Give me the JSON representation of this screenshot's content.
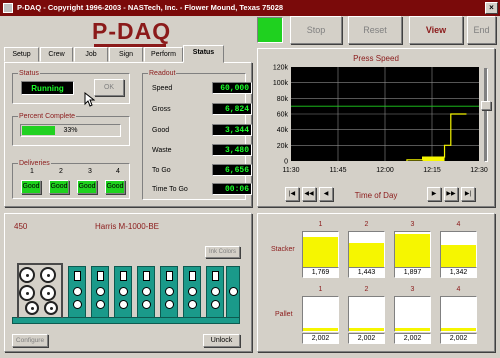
{
  "window": {
    "title": "P-DAQ - Copyright 1996-2003 - NASTech, Inc. - Flower Mound, Texas  75028",
    "close_glyph": "×"
  },
  "logo": "P-DAQ",
  "toolbar": {
    "stop": "Stop",
    "reset": "Reset",
    "view": "View",
    "end": "End"
  },
  "tabs": [
    "Setup",
    "Crew",
    "Job",
    "Sign",
    "Perform",
    "Status"
  ],
  "status": {
    "group": "Status",
    "value": "Running",
    "ok": "OK"
  },
  "percent": {
    "group": "Percent Complete",
    "label": "33%",
    "fraction": 0.33
  },
  "deliveries": {
    "group": "Deliveries",
    "numbers": [
      "1",
      "2",
      "3",
      "4"
    ],
    "values": [
      "Good",
      "Good",
      "Good",
      "Good"
    ]
  },
  "readout": {
    "group": "Readout",
    "rows": [
      {
        "label": "Speed",
        "value": "60,000"
      },
      {
        "label": "Gross",
        "value": "6,824"
      },
      {
        "label": "Good",
        "value": "3,344"
      },
      {
        "label": "Waste",
        "value": "3,480"
      },
      {
        "label": "To Go",
        "value": "6,656"
      },
      {
        "label": "Time To Go",
        "value": "00:06"
      }
    ]
  },
  "chart_data": {
    "type": "line",
    "title": "Press Speed",
    "xlabel": "Time of Day",
    "ylabel": "",
    "x_ticks": [
      "11:30",
      "11:45",
      "12:00",
      "12:15",
      "12:30"
    ],
    "y_ticks": [
      "0",
      "20k",
      "40k",
      "60k",
      "80k",
      "100k",
      "120k"
    ],
    "ylim": [
      0,
      120000
    ],
    "grid": true,
    "series": [
      {
        "points": [
          [
            "12:07",
            0
          ],
          [
            "12:07",
            1500
          ],
          [
            "12:12",
            1500
          ],
          [
            "12:12",
            5000
          ],
          [
            "12:19",
            5000
          ],
          [
            "12:19",
            20000
          ],
          [
            "12:21",
            20000
          ],
          [
            "12:21",
            60000
          ],
          [
            "12:26",
            60000
          ]
        ]
      }
    ],
    "setpoint": 70000,
    "colors": {
      "line": "#f6f600",
      "setpoint": "#1fd11f",
      "grid": "#8a8a8a",
      "bg": "#000000"
    }
  },
  "nav": {
    "first": "|◀",
    "prev2": "◀◀",
    "prev": "◀",
    "next": "▶",
    "next2": "▶▶",
    "last": "▶|"
  },
  "press": {
    "id": "450",
    "name": "Harris M-1000-BE",
    "ink_colors": "Ink Colors",
    "configure": "Configure",
    "unlock": "Unlock"
  },
  "stacker": {
    "label": "Stacker",
    "items": [
      {
        "num": "1",
        "value": "1,769",
        "level": 0.88
      },
      {
        "num": "2",
        "value": "1,443",
        "level": 0.72
      },
      {
        "num": "3",
        "value": "1,897",
        "level": 0.95
      },
      {
        "num": "4",
        "value": "1,342",
        "level": 0.67
      }
    ]
  },
  "pallet": {
    "label": "Pallet",
    "items": [
      {
        "num": "1",
        "value": "2,002",
        "level": 0.08
      },
      {
        "num": "2",
        "value": "2,002",
        "level": 0.08
      },
      {
        "num": "3",
        "value": "2,002",
        "level": 0.08
      },
      {
        "num": "4",
        "value": "2,002",
        "level": 0.08
      }
    ]
  },
  "colors": {
    "brand": "#8b1a1a",
    "running_bg": "#000000",
    "running_fg": "#1bff2a",
    "good": "#1ed21e",
    "gauge_fill": "#f6f600",
    "progress": "#21d121",
    "press_unit": "#1a9a8a"
  }
}
